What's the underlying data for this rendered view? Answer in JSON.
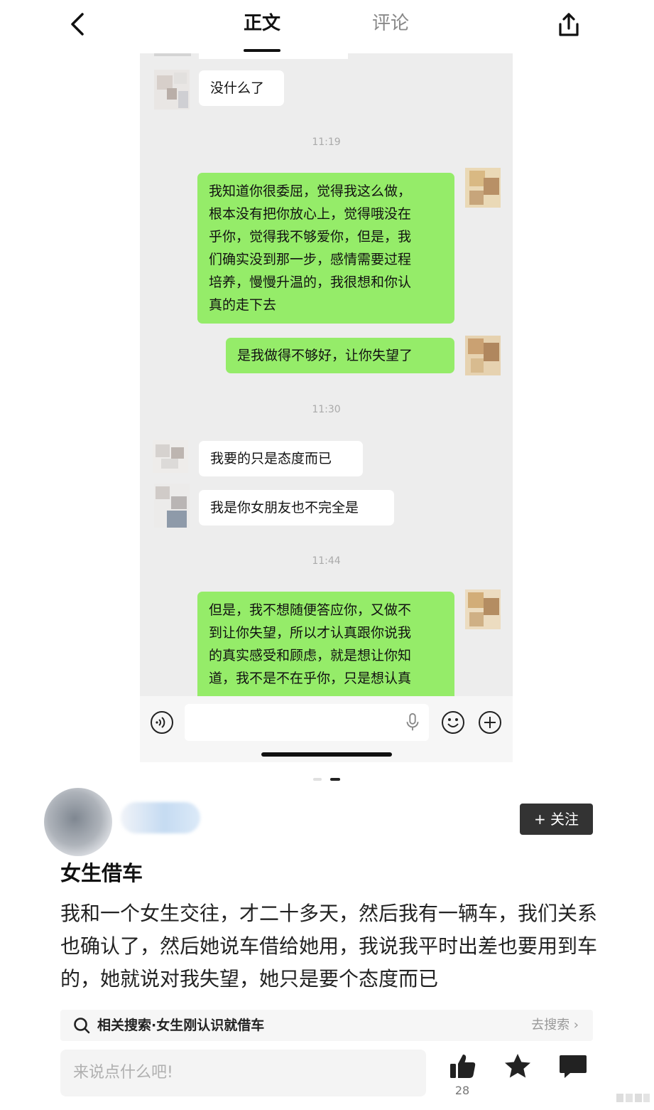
{
  "nav": {
    "tab_main": "正文",
    "tab_comments": "评论"
  },
  "chat": {
    "msg_partial": "",
    "msg1": "没什么了",
    "ts1": "11:19",
    "msg2": "我知道你很委屈，觉得我这么做，\n根本没有把你放心上，觉得哦没在\n乎你，觉得我不够爱你，但是，我\n们确实没到那一步，感情需要过程\n培养，慢慢升温的，我很想和你认\n真的走下去",
    "msg3": "是我做得不够好，让你失望了",
    "ts2": "11:30",
    "msg4": "我要的只是态度而已",
    "msg5": "我是你女朋友也不完全是",
    "ts3": "11:44",
    "msg6": "但是，我不想随便答应你，又做不\n到让你失望，所以才认真跟你说我\n的真实感受和顾虑，就是想让你知\n道，我不是不在乎你，只是想认真"
  },
  "author": {
    "follow_label": "+ 关注"
  },
  "post": {
    "title": "女生借车",
    "body": "我和一个女生交往，才二十多天，然后我有一辆车，我们关系也确认了，然后她说车借给她用，我说我平时出差也要用到车的，她就说对我失望，她只是要个态度而已"
  },
  "related": {
    "text": "相关搜索·女生刚认识就借车",
    "go": "去搜索 ›"
  },
  "bottom": {
    "comment_placeholder": "来说点什么吧!",
    "like_count": "28"
  },
  "icons": {
    "back": "chevron-left-icon",
    "share": "share-icon",
    "voice": "voice-icon",
    "mic": "mic-icon",
    "emoji": "emoji-icon",
    "plus": "plus-icon",
    "search": "search-icon",
    "like": "thumbs-up-icon",
    "favorite": "star-icon",
    "comment": "comment-icon"
  },
  "colors": {
    "chat_bg": "#ededed",
    "outgoing_bubble": "#95ec69",
    "follow_button": "#333333"
  }
}
